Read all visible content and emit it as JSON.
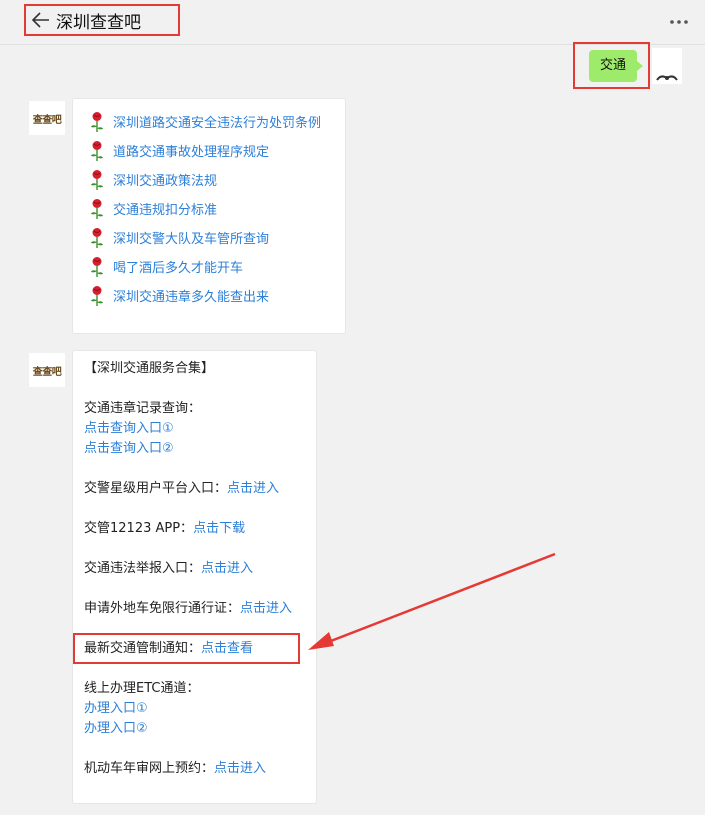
{
  "header": {
    "title": "深圳查查吧",
    "back_icon": "back-arrow-icon",
    "more_icon": "more-dots-icon"
  },
  "user_message": {
    "text": "交通",
    "bubble_color": "#9eea6a"
  },
  "bot": {
    "avatar_text": "查查吧"
  },
  "message1": {
    "items": [
      {
        "label": "深圳道路交通安全违法行为处罚条例"
      },
      {
        "label": "道路交通事故处理程序规定"
      },
      {
        "label": "深圳交通政策法规"
      },
      {
        "label": "交通违规扣分标准"
      },
      {
        "label": "深圳交警大队及车管所查询"
      },
      {
        "label": "喝了酒后多久才能开车"
      },
      {
        "label": "深圳交通违章多久能查出来"
      }
    ]
  },
  "message2": {
    "heading": "【深圳交通服务合集】",
    "violation_query": {
      "label": "交通违章记录查询：",
      "link1": "点击查询入口①",
      "link2": "点击查询入口②"
    },
    "police_platform": {
      "label": "交警星级用户平台入口：",
      "link": "点击进入"
    },
    "app_12123": {
      "label": "交管12123 APP：",
      "link": "点击下载"
    },
    "report": {
      "label": "交通违法举报入口：",
      "link": "点击进入"
    },
    "nonlocal_pass": {
      "label": "申请外地车免限行通行证：",
      "link": "点击进入"
    },
    "latest_notice": {
      "label": "最新交通管制通知：",
      "link": "点击查看"
    },
    "etc": {
      "label": "线上办理ETC通道：",
      "link1": "办理入口①",
      "link2": "办理入口②"
    },
    "inspection": {
      "label": "机动车年审网上预约：",
      "link": "点击进入"
    }
  },
  "colors": {
    "link": "#2c7fd8",
    "annotation": "#e53935"
  }
}
